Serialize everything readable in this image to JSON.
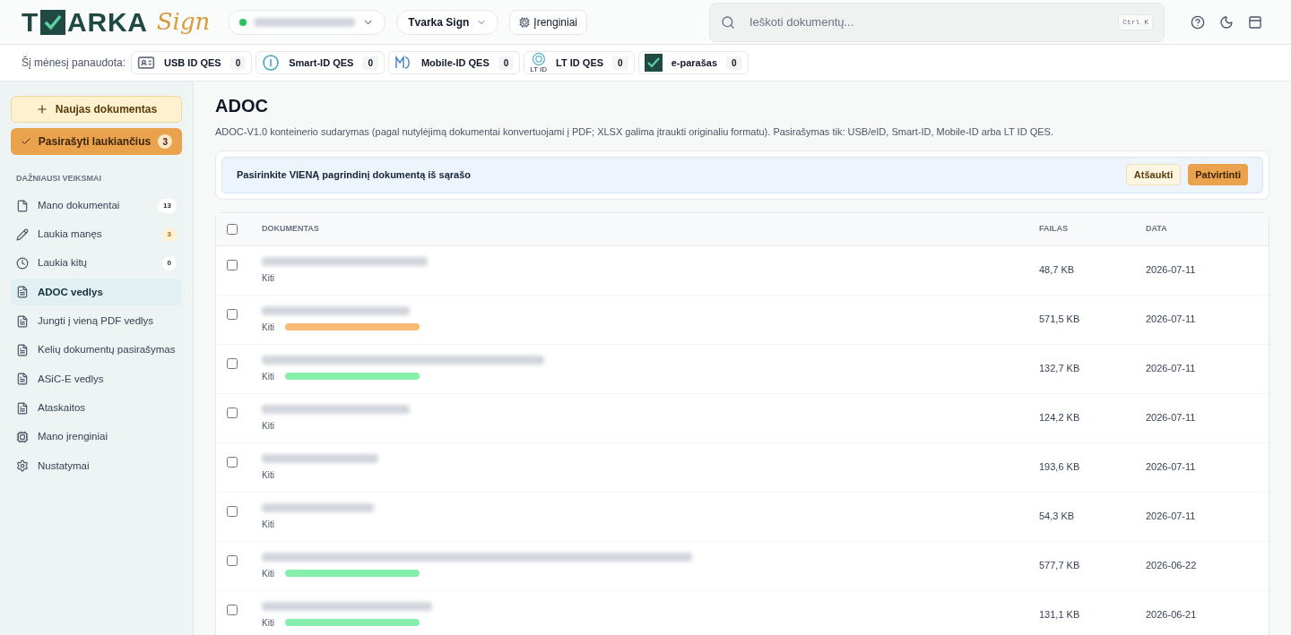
{
  "logo": {
    "left": "T",
    "right": "ARKA",
    "script": "Sign"
  },
  "header": {
    "org_select": {
      "online": true
    },
    "workspace": "Tvarka Sign",
    "devices": "Įrenginiai",
    "search": {
      "placeholder": "Ieškoti dokumentų...",
      "shortcut": "Ctrl K"
    }
  },
  "usage": {
    "label": "Šį mėnesį panaudota:",
    "items": [
      {
        "kind": "usb",
        "label": "USB ID QES",
        "count": "0"
      },
      {
        "kind": "smartid",
        "label": "Smart-ID QES",
        "count": "0"
      },
      {
        "kind": "mobileid",
        "label": "Mobile-ID QES",
        "count": "0"
      },
      {
        "kind": "ltid",
        "label": "LT ID QES",
        "count": "0",
        "sub": "LT ID"
      },
      {
        "kind": "eparasas",
        "label": "e-parašas",
        "count": "0"
      }
    ]
  },
  "sidebar": {
    "new_button": "Naujas dokumentas",
    "sign_button": {
      "label": "Pasirašyti laukiančius",
      "count": "3"
    },
    "section": "DAŽNIAUSI VEIKSMAI",
    "items": [
      {
        "kind": "file",
        "label": "Mano dokumentai",
        "count": "13",
        "highlighted": false,
        "selected": false
      },
      {
        "kind": "pencil",
        "label": "Laukia manęs",
        "count": "3",
        "highlighted": true,
        "selected": false
      },
      {
        "kind": "clock",
        "label": "Laukia kitų",
        "count": "0",
        "highlighted": false,
        "selected": false
      },
      {
        "kind": "doc",
        "label": "ADOC vedlys",
        "selected": true
      },
      {
        "kind": "doc",
        "label": "Jungti į vieną PDF vedlys",
        "selected": false
      },
      {
        "kind": "doc",
        "label": "Kelių dokumentų pasirašymas",
        "selected": false
      },
      {
        "kind": "doc",
        "label": "ASiC-E vedlys",
        "selected": false
      },
      {
        "kind": "doc",
        "label": "Ataskaitos",
        "selected": false
      },
      {
        "kind": "device",
        "label": "Mano įrenginiai",
        "selected": false
      },
      {
        "kind": "gear",
        "label": "Nustatymai",
        "selected": false
      }
    ]
  },
  "page": {
    "title": "ADOC",
    "description": "ADOC-V1.0 konteinerio sudarymas (pagal nutylėjimą dokumentai konvertuojami į PDF; XLSX galima įtraukti originaliu formatu). Pasirašymas tik: USB/eID, Smart-ID, Mobile-ID arba LT ID QES.",
    "banner": {
      "text": "Pasirinkite VIENĄ pagrindinį dokumentą iš sąrašo",
      "cancel": "Atšaukti",
      "confirm": "Patvirtinti"
    }
  },
  "table": {
    "columns": [
      "DOKUMENTAS",
      "FAILAS",
      "DATA"
    ],
    "all_checked": false,
    "rows": [
      {
        "checked": false,
        "category": "Kiti",
        "size": "48,7 KB",
        "date": "2026-07-11"
      },
      {
        "checked": false,
        "category": "Kiti",
        "color": "#fdba74",
        "size": "571,5 KB",
        "date": "2026-07-11"
      },
      {
        "checked": false,
        "category": "Kiti",
        "color": "#86efac",
        "size": "132,7 KB",
        "date": "2026-07-11"
      },
      {
        "checked": false,
        "category": "Kiti",
        "size": "124,2 KB",
        "date": "2026-07-11"
      },
      {
        "checked": false,
        "category": "Kiti",
        "size": "193,6 KB",
        "date": "2026-07-11"
      },
      {
        "checked": false,
        "category": "Kiti",
        "size": "54,3 KB",
        "date": "2026-07-11"
      },
      {
        "checked": false,
        "category": "Kiti",
        "color": "#86efac",
        "size": "577,7 KB",
        "date": "2026-06-22"
      },
      {
        "checked": false,
        "category": "Kiti",
        "color": "#86efac",
        "size": "131,1 KB",
        "date": "2026-06-21"
      }
    ]
  }
}
